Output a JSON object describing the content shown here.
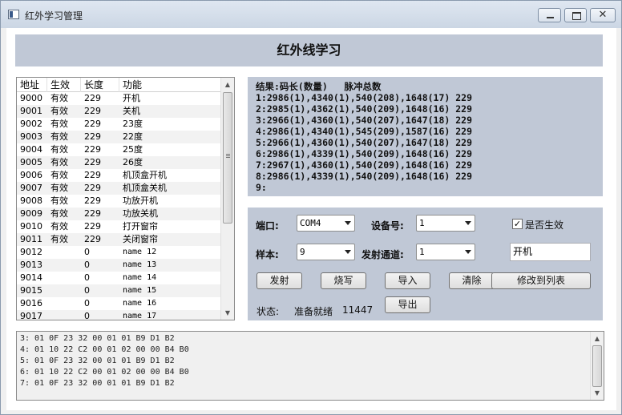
{
  "window": {
    "title": "红外学习管理"
  },
  "header": {
    "title": "红外线学习"
  },
  "table": {
    "columns": [
      "地址",
      "生效",
      "长度",
      "功能"
    ],
    "rows": [
      {
        "addr": "9000",
        "valid": "有效",
        "len": "229",
        "func": "开机"
      },
      {
        "addr": "9001",
        "valid": "有效",
        "len": "229",
        "func": "关机"
      },
      {
        "addr": "9002",
        "valid": "有效",
        "len": "229",
        "func": "23度"
      },
      {
        "addr": "9003",
        "valid": "有效",
        "len": "229",
        "func": "22度"
      },
      {
        "addr": "9004",
        "valid": "有效",
        "len": "229",
        "func": "25度"
      },
      {
        "addr": "9005",
        "valid": "有效",
        "len": "229",
        "func": "26度"
      },
      {
        "addr": "9006",
        "valid": "有效",
        "len": "229",
        "func": "机顶盒开机"
      },
      {
        "addr": "9007",
        "valid": "有效",
        "len": "229",
        "func": "机顶盒关机"
      },
      {
        "addr": "9008",
        "valid": "有效",
        "len": "229",
        "func": "功放开机"
      },
      {
        "addr": "9009",
        "valid": "有效",
        "len": "229",
        "func": "功放关机"
      },
      {
        "addr": "9010",
        "valid": "有效",
        "len": "229",
        "func": "打开窗帘"
      },
      {
        "addr": "9011",
        "valid": "有效",
        "len": "229",
        "func": "关闭窗帘"
      },
      {
        "addr": "9012",
        "valid": "",
        "len": "0",
        "func": "name 12"
      },
      {
        "addr": "9013",
        "valid": "",
        "len": "0",
        "func": "name 13"
      },
      {
        "addr": "9014",
        "valid": "",
        "len": "0",
        "func": "name 14"
      },
      {
        "addr": "9015",
        "valid": "",
        "len": "0",
        "func": "name 15"
      },
      {
        "addr": "9016",
        "valid": "",
        "len": "0",
        "func": "name 16"
      },
      {
        "addr": "9017",
        "valid": "",
        "len": "0",
        "func": "name 17"
      }
    ]
  },
  "results": {
    "header": "结果:码长(数量)   脉冲总数",
    "lines": [
      "1:2986(1),4340(1),540(208),1648(17) 229",
      "2:2985(1),4362(1),540(209),1648(16) 229",
      "3:2966(1),4360(1),540(207),1647(18) 229",
      "4:2986(1),4340(1),545(209),1587(16) 229",
      "5:2966(1),4360(1),540(207),1647(18) 229",
      "6:2986(1),4339(1),540(209),1648(16) 229",
      "7:2967(1),4360(1),540(209),1648(16) 229",
      "8:2986(1),4339(1),540(209),1648(16) 229",
      "9:"
    ]
  },
  "controls": {
    "port_label": "端口:",
    "port_value": "COM4",
    "device_label": "设备号:",
    "device_value": "1",
    "enabled_label": "是否生效",
    "enabled_mark": "✓",
    "sample_label": "样本:",
    "sample_value": "9",
    "channel_label": "发射通道:",
    "channel_value": "1",
    "name_value": "开机",
    "buttons": {
      "send": "发射",
      "burn": "烧写",
      "import": "导入",
      "clear": "清除",
      "modify": "修改到列表",
      "export": "导出"
    },
    "status_label": "状态:",
    "status_text": "准备就绪",
    "status_count": "11447"
  },
  "log": {
    "lines": [
      "3: 01 0F 23 32 00 01 01 B9 D1 B2",
      "4: 01 10 22 C2 00 01 02 00 00 B4 B0",
      "5: 01 0F 23 32 00 01 01 B9 D1 B2",
      "6: 01 10 22 C2 00 01 02 00 00 B4 B0",
      "7: 01 0F 23 32 00 01 01 B9 D1 B2"
    ]
  }
}
